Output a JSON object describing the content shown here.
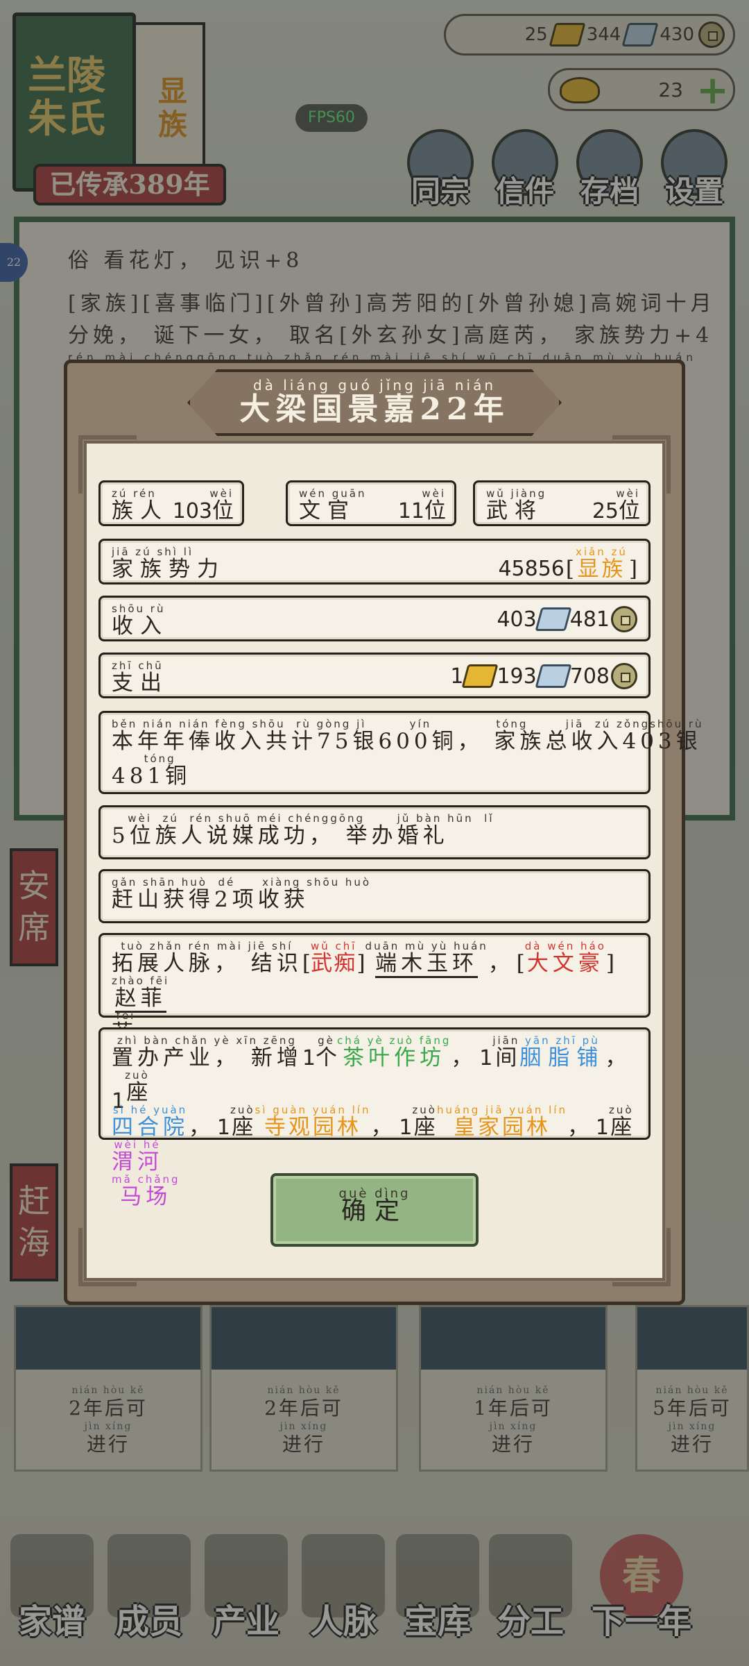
{
  "family": {
    "name": "兰陵朱氏",
    "rank": "显族",
    "heritage": "已传承389年"
  },
  "fps": "FPS60",
  "resources": {
    "v1": "25",
    "v2": "344",
    "v3": "430",
    "gold_count": "23"
  },
  "top_menu": [
    "同宗",
    "信件",
    "存档",
    "设置"
  ],
  "side_avatar": "22",
  "background_log": {
    "line1": "俗 看花灯， 见识+8",
    "line2": "[家族][喜事临门][外曾孙]高芳阳的[外曾孙媳]高婉词十月",
    "line3": "分娩， 诞下一女， 取名[外玄孙女]高庭芮， 家族势力+4",
    "line4": "rén mài chéngqōng tuò zhǎn rén mài    jiē shí wū chī duān mù yù huán"
  },
  "side_tags": [
    "安席",
    "赶海"
  ],
  "cards": [
    {
      "years": "2",
      "a": "年后可",
      "a_py": "nián hòu kě",
      "b": "进行",
      "b_py": "jìn xíng"
    },
    {
      "years": "2",
      "a": "年后可",
      "a_py": "nián hòu kě",
      "b": "进行",
      "b_py": "jìn xíng"
    },
    {
      "years": "1",
      "a": "年后可",
      "a_py": "nián hòu kě",
      "b": "进行",
      "b_py": "jìn xíng"
    },
    {
      "years": "5",
      "a": "年后可",
      "a_py": "nián hòu kě",
      "b": "进行",
      "b_py": "jìn xíng"
    }
  ],
  "bottom_nav": [
    "家谱",
    "成员",
    "产业",
    "人脉",
    "宝库",
    "分工",
    "下一年"
  ],
  "spring_char": "春",
  "dialog": {
    "title_py": "dà liáng guó jǐng jiā          nián",
    "title": "大梁国景嘉22年",
    "stats": [
      {
        "label": "族人",
        "label_py": "zú rén",
        "value": "103",
        "unit": "位",
        "unit_py": "wèi"
      },
      {
        "label": "文官",
        "label_py": "wén guān",
        "value": "11",
        "unit": "位",
        "unit_py": "wèi"
      },
      {
        "label": "武将",
        "label_py": "wǔ jiàng",
        "value": "25",
        "unit": "位",
        "unit_py": "wèi"
      }
    ],
    "power": {
      "label": "家族势力",
      "label_py": "jiā zú shì lì",
      "value": "45856",
      "rank": "显族",
      "rank_py": "xiǎn zú"
    },
    "income": {
      "label": "收入",
      "label_py": "shōu rù",
      "silver": "403",
      "copper": "481"
    },
    "expense": {
      "label": "支出",
      "label_py": "zhī chū",
      "gold": "1",
      "silver": "193",
      "copper": "708"
    },
    "salary": {
      "py1": "běn nián nián fèng shōu  rù gòng jì        yín            tóng       jiā  zú zǒngshōu rù          yín",
      "t1": "本年年俸收入共计75银600铜， 家族总收入403银",
      "py2": "      tóng",
      "t2": "481铜"
    },
    "matchmaking": {
      "py": "   wèi  zú  rén shuō méi chénggōng      jǔ bàn hūn  lǐ",
      "text": "5位族人说媒成功， 举办婚礼"
    },
    "harvest": {
      "py": "gǎn shān huò  dé     xiàng shōu huò",
      "text": "赶山获得2项收获"
    },
    "network": {
      "prefix": "拓展人脉， 结识",
      "prefix_py": "tuò zhǎn rén mài   jiē shí",
      "tag1": "武痴",
      "tag1_py": "wǔ chī",
      "name1": "端木玉环",
      "name1_py": "duān mù yù huán",
      "tag2": "大文豪",
      "tag2_py": "dà wén háo",
      "name2a": "赵菲",
      "name2a_py": "zhào fēi",
      "name2b": "菲",
      "name2b_py": "fēi"
    },
    "industry": {
      "prefix": "置办产业， 新增",
      "prefix_py": "zhì bàn chǎn yè   xīn zēng",
      "n1": "1",
      "u1": "个",
      "u1_py": "gè",
      "i1": "茶叶作坊",
      "i1_py": "chá yè zuò fāng",
      "n2": "1",
      "u2": "间",
      "u2_py": "jiān",
      "i2": "胭脂铺",
      "i2_py": "yān zhī pù",
      "n3": "1",
      "u3": "座",
      "u3_py": "zuò",
      "i3": "四合院",
      "i3_py": "sì hé yuàn",
      "n4": "1",
      "u4": "座",
      "u4_py": "zuò",
      "i4": "寺观园林",
      "i4_py": "sì guàn yuán lín",
      "n5": "1",
      "u5": "座",
      "u5_py": "zuò",
      "i5": "皇家园林",
      "i5_py": "huáng jiā yuán lín",
      "n6": "1",
      "u6": "座",
      "u6_py": "zuò",
      "i6a": "渭河",
      "i6a_py": "wèi hé",
      "i6b": "马场",
      "i6b_py": "mǎ chǎng"
    },
    "confirm": {
      "label": "确定",
      "py": "què dìng"
    }
  },
  "colors": {
    "red": "#d2332f",
    "green": "#3aa84a",
    "blue": "#3c8fd8",
    "orange": "#e5951b",
    "pink": "#c44ad4"
  }
}
